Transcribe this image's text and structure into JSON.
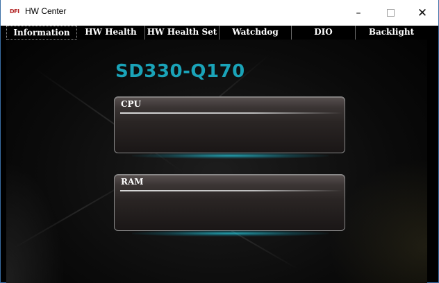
{
  "window": {
    "logo_text": "DFI",
    "title": "HW Center",
    "minimize_glyph": "–",
    "close_glyph": "✕"
  },
  "tabs": [
    {
      "label": "Information",
      "active": true
    },
    {
      "label": "HW Health",
      "active": false
    },
    {
      "label": "HW Health Set",
      "active": false
    },
    {
      "label": "Watchdog",
      "active": false
    },
    {
      "label": "DIO",
      "active": false
    },
    {
      "label": "Backlight",
      "active": false
    }
  ],
  "main": {
    "model_name": "SD330-Q170",
    "cpu_panel": {
      "label": "CPU"
    },
    "ram_panel": {
      "label": "RAM"
    }
  },
  "colors": {
    "accent_teal": "#1aa3b8",
    "background": "#0b0b0b"
  },
  "icons": [
    "dfi-logo-icon",
    "minimize-icon",
    "maximize-icon",
    "close-icon"
  ]
}
